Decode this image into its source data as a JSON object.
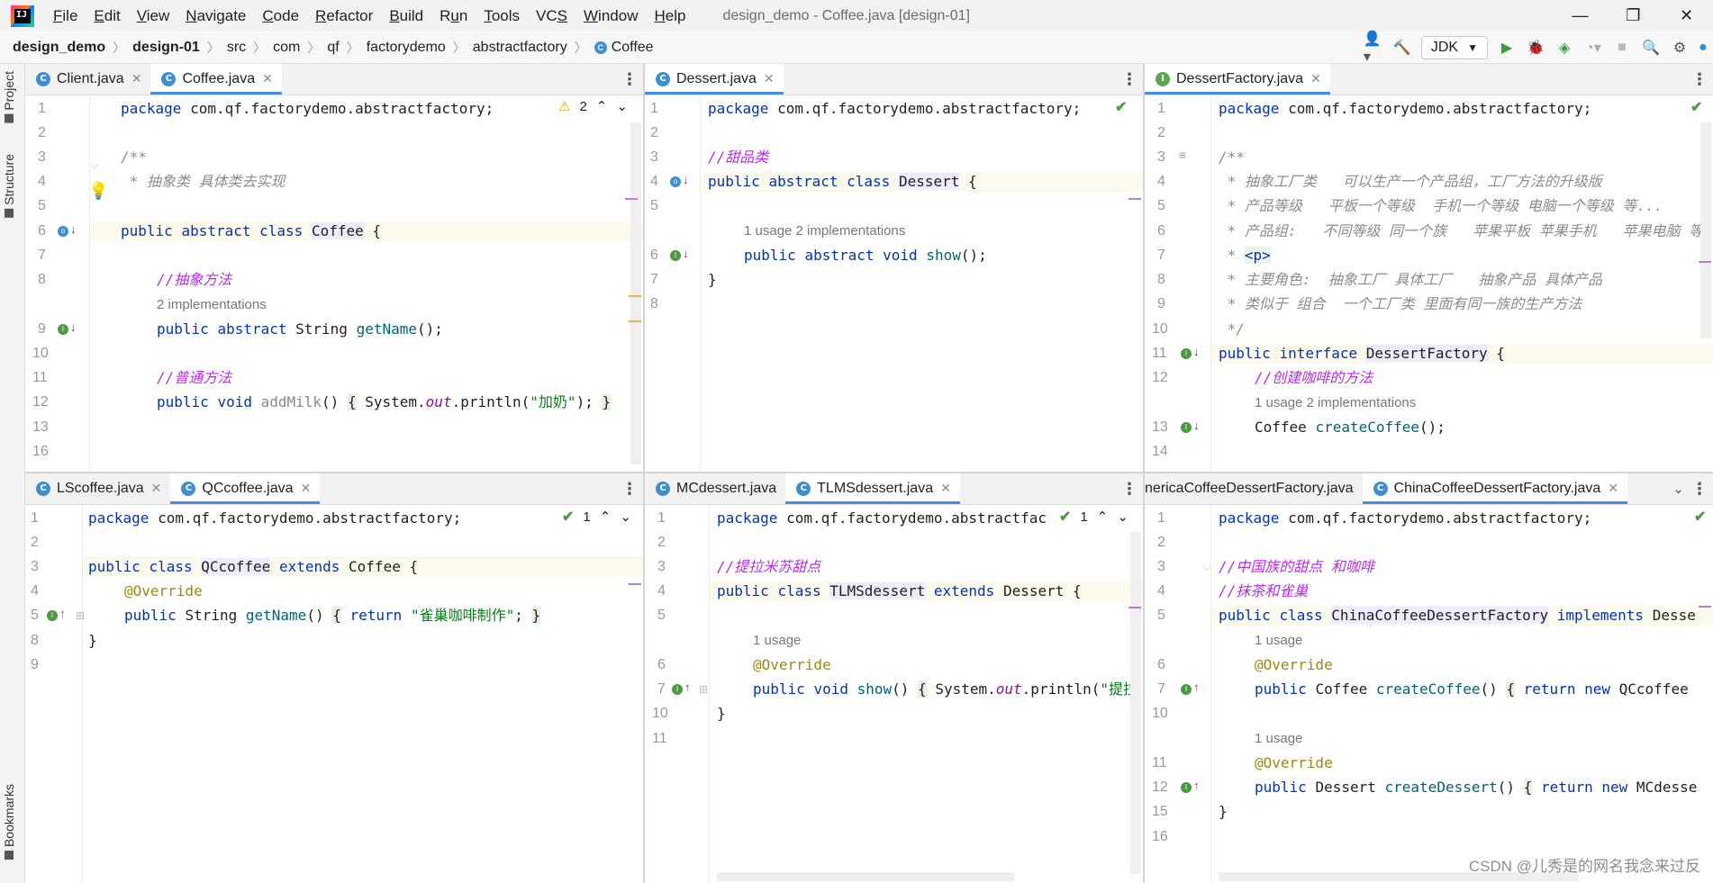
{
  "window": {
    "title": "design_demo - Coffee.java [design-01]",
    "logo_text": "IJ",
    "controls": [
      "—",
      "❐",
      "✕"
    ]
  },
  "menu": [
    {
      "pre": "",
      "u": "F",
      "post": "ile"
    },
    {
      "pre": "",
      "u": "E",
      "post": "dit"
    },
    {
      "pre": "",
      "u": "V",
      "post": "iew"
    },
    {
      "pre": "",
      "u": "N",
      "post": "avigate"
    },
    {
      "pre": "",
      "u": "C",
      "post": "ode"
    },
    {
      "pre": "",
      "u": "R",
      "post": "efactor"
    },
    {
      "pre": "",
      "u": "B",
      "post": "uild"
    },
    {
      "pre": "R",
      "u": "u",
      "post": "n"
    },
    {
      "pre": "",
      "u": "T",
      "post": "ools"
    },
    {
      "pre": "VC",
      "u": "S",
      "post": ""
    },
    {
      "pre": "",
      "u": "W",
      "post": "indow"
    },
    {
      "pre": "",
      "u": "H",
      "post": "elp"
    }
  ],
  "breadcrumbs": [
    "design_demo",
    "design-01",
    "src",
    "com",
    "qf",
    "factorydemo",
    "abstractfactory",
    "Coffee"
  ],
  "toolbar": {
    "jdk_label": "JDK"
  },
  "sidebar": {
    "project": "Project",
    "structure": "Structure",
    "bookmarks": "Bookmarks"
  },
  "panes": {
    "p1": {
      "tabs": [
        {
          "label": "Client.java",
          "icon": "C",
          "active": false
        },
        {
          "label": "Coffee.java",
          "icon": "C",
          "active": true
        }
      ],
      "inspection": {
        "warning_count": "2"
      },
      "line_numbers": [
        "1",
        "2",
        "3",
        "4",
        "5",
        "6",
        "7",
        "8",
        "9",
        "10",
        "11",
        "12",
        "13",
        "16"
      ],
      "hints": [
        "2 implementations"
      ]
    },
    "p2": {
      "tabs": [
        {
          "label": "Dessert.java",
          "icon": "C",
          "active": true
        }
      ],
      "line_numbers": [
        "1",
        "2",
        "3",
        "4",
        "5",
        "6",
        "7",
        "8"
      ],
      "hints": [
        "1 usage   2 implementations"
      ]
    },
    "p3": {
      "tabs": [
        {
          "label": "DessertFactory.java",
          "icon": "I",
          "active": true
        }
      ],
      "line_numbers": [
        "1",
        "2",
        "3",
        "4",
        "5",
        "6",
        "7",
        "8",
        "9",
        "10",
        "11",
        "12",
        "13",
        "14"
      ],
      "hints": [
        "1 usage   2 implementations"
      ]
    },
    "p4": {
      "tabs": [
        {
          "label": "LScoffee.java",
          "icon": "C",
          "active": false
        },
        {
          "label": "QCcoffee.java",
          "icon": "C",
          "active": true
        }
      ],
      "inspection": {
        "ok_count": "1"
      },
      "line_numbers": [
        "1",
        "2",
        "3",
        "4",
        "5",
        "8",
        "9"
      ]
    },
    "p5": {
      "tabs": [
        {
          "label": "MCdessert.java",
          "icon": "C",
          "active": false
        },
        {
          "label": "TLMSdessert.java",
          "icon": "C",
          "active": true
        }
      ],
      "inspection": {
        "ok_count": "1"
      },
      "line_numbers": [
        "1",
        "2",
        "3",
        "4",
        "5",
        "6",
        "7",
        "10",
        "11"
      ],
      "hints": [
        "1 usage"
      ]
    },
    "p6": {
      "tabs": [
        {
          "label": "nericaCoffeeDessertFactory.java",
          "icon": "",
          "active": false
        },
        {
          "label": "ChinaCoffeeDessertFactory.java",
          "icon": "C",
          "active": true
        }
      ],
      "line_numbers": [
        "1",
        "2",
        "3",
        "4",
        "5",
        "6",
        "7",
        "10",
        "11",
        "12",
        "15",
        "16"
      ],
      "hints": [
        "1 usage",
        "1 usage"
      ]
    }
  },
  "code": {
    "pkg": "package",
    "pkg_name": " com.qf.factorydemo.abstractfactory;",
    "pkg_name_trunc": " com.qf.factorydemo.abstractfac",
    "kw_public": "public",
    "kw_abstract": "abstract",
    "kw_class": "class",
    "kw_interface": "interface",
    "kw_void": "void",
    "kw_extends": "extends",
    "kw_implements": "implements",
    "kw_return": "return",
    "kw_new": "new",
    "override": "@Override",
    "p1": {
      "doc_open": "/**",
      "doc_line": " * 抽象类 具体类去实现",
      "class_name": "Coffee",
      "c_abstract": "//抽象方法",
      "string_type": "String",
      "get_name": "getName",
      "c_normal": "//普通方法",
      "add_milk": "addMilk",
      "sys": "System.",
      "out": "out",
      "println": ".println(",
      "milk_str": "\"加奶\"",
      "close": ");"
    },
    "p2": {
      "comment": "//甜品类",
      "class_name": "Dessert",
      "show": "show"
    },
    "p3": {
      "doc_open": "/**",
      "doc1": " * 抽象工厂类   可以生产一个产品组，工厂方法的升级版",
      "doc2": " * 产品等级   平板一个等级  手机一个等级 电脑一个等级 等...",
      "doc3": " * 产品组:   不同等级 同一个族   苹果平板 苹果手机   苹果电脑 等",
      "doc4_pre": " * ",
      "doc4_tag": "<p>",
      "doc5": " * 主要角色:  抽象工厂 具体工厂   抽象产品 具体产品",
      "doc6": " * 类似于 组合  一个工厂类 里面有同一族的生产方法",
      "doc_close": " */",
      "iface": "DessertFactory",
      "comment": "//创建咖啡的方法",
      "coffee_type": "Coffee",
      "create_coffee": "createCoffee"
    },
    "p4": {
      "class_name": "QCcoffee",
      "parent": "Coffee",
      "string_type": "String",
      "get_name": "getName",
      "ret_str": "\"雀巢咖啡制作\""
    },
    "p5": {
      "comment": "//提拉米苏甜点",
      "class_name": "TLMSdessert",
      "parent": "Dessert",
      "show": "show",
      "sys": "System.",
      "out": "out",
      "println": ".println(",
      "str_trunc": "\"提拉"
    },
    "p6": {
      "c1": "//中国族的甜点 和咖啡",
      "c2": "//抹茶和雀巢",
      "class_name": "ChinaCoffeeDessertFactory",
      "iface_trunc": "Desse",
      "coffee_type": "Coffee",
      "create_coffee": "createCoffee",
      "ret1": "QCcoffee",
      "dessert_type": "Dessert",
      "create_dessert": "createDessert",
      "ret2": "MCdesse"
    }
  },
  "watermark": "CSDN @儿秀是的网名我念来过反"
}
